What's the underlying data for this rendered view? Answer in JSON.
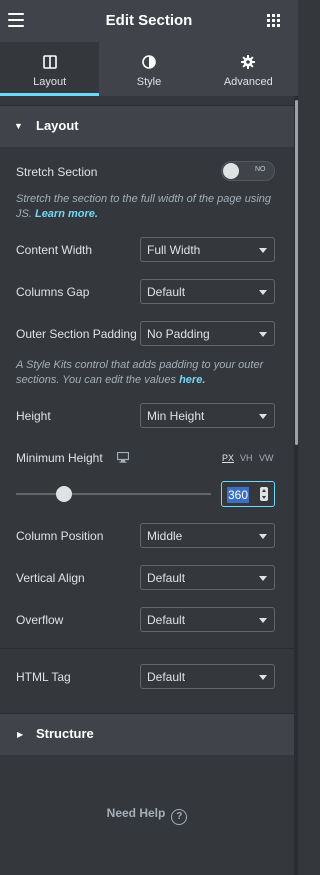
{
  "header": {
    "title": "Edit Section"
  },
  "tabs": [
    {
      "label": "Layout",
      "icon": "columns-icon",
      "active": true
    },
    {
      "label": "Style",
      "icon": "half-circle-icon"
    },
    {
      "label": "Advanced",
      "icon": "gear-icon"
    }
  ],
  "layout_section": {
    "title": "Layout"
  },
  "stretch": {
    "label": "Stretch Section",
    "toggle_text": "NO",
    "help_text": "Stretch the section to the full width of the page using JS.",
    "help_link": "Learn more."
  },
  "content_width": {
    "label": "Content Width",
    "value": "Full Width"
  },
  "columns_gap": {
    "label": "Columns Gap",
    "value": "Default"
  },
  "outer_padding": {
    "label": "Outer Section Padding",
    "value": "No Padding",
    "help_text": "A Style Kits control that adds padding to your outer sections. You can edit the values",
    "help_link": "here."
  },
  "height": {
    "label": "Height",
    "value": "Min Height"
  },
  "min_height": {
    "label": "Minimum Height",
    "units": [
      "PX",
      "VH",
      "VW"
    ],
    "active_unit": "PX",
    "value": "360"
  },
  "column_position": {
    "label": "Column Position",
    "value": "Middle"
  },
  "vertical_align": {
    "label": "Vertical Align",
    "value": "Default"
  },
  "overflow": {
    "label": "Overflow",
    "value": "Default"
  },
  "html_tag": {
    "label": "HTML Tag",
    "value": "Default"
  },
  "structure_section": {
    "title": "Structure"
  },
  "footer": {
    "help_label": "Need Help",
    "help_icon": "?"
  },
  "colors": {
    "accent": "#71d7f7",
    "panel": "#34383c",
    "header": "#404349"
  }
}
